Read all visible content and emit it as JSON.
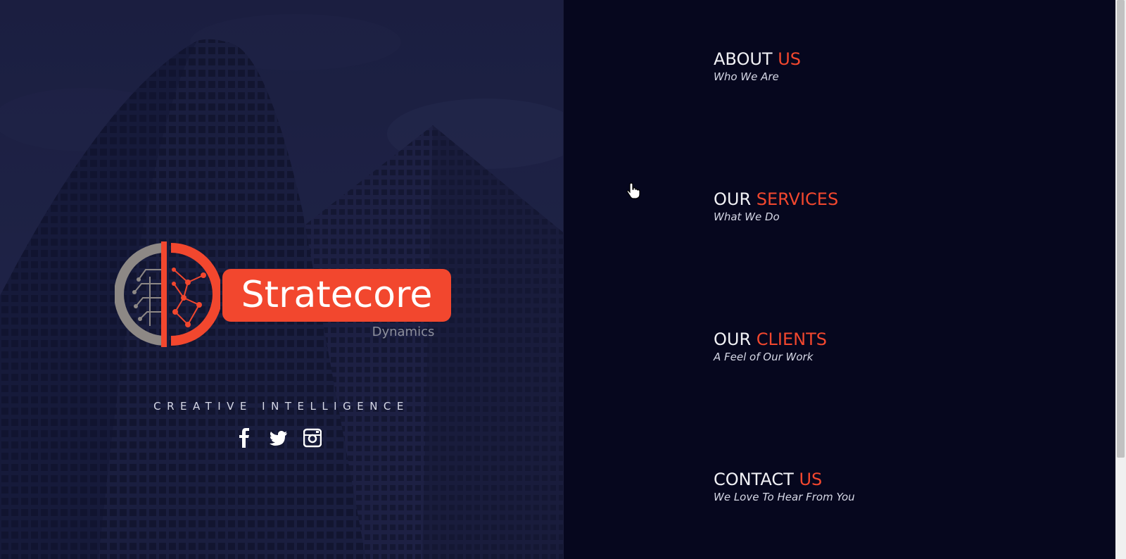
{
  "brand": {
    "name": "Stratecore",
    "sub": "Dynamics",
    "tagline": "CREATIVE INTELLIGENCE",
    "accent_color": "#f2472e"
  },
  "social": [
    {
      "name": "facebook-icon"
    },
    {
      "name": "twitter-icon"
    },
    {
      "name": "instagram-icon"
    }
  ],
  "menu": [
    {
      "title_main": "ABOUT",
      "title_accent": "US",
      "subtitle": "Who We Are"
    },
    {
      "title_main": "OUR",
      "title_accent": "SERVICES",
      "subtitle": "What We Do"
    },
    {
      "title_main": "OUR",
      "title_accent": "CLIENTS",
      "subtitle": "A Feel of Our Work"
    },
    {
      "title_main": "CONTACT",
      "title_accent": "US",
      "subtitle": "We Love To Hear From You"
    }
  ]
}
